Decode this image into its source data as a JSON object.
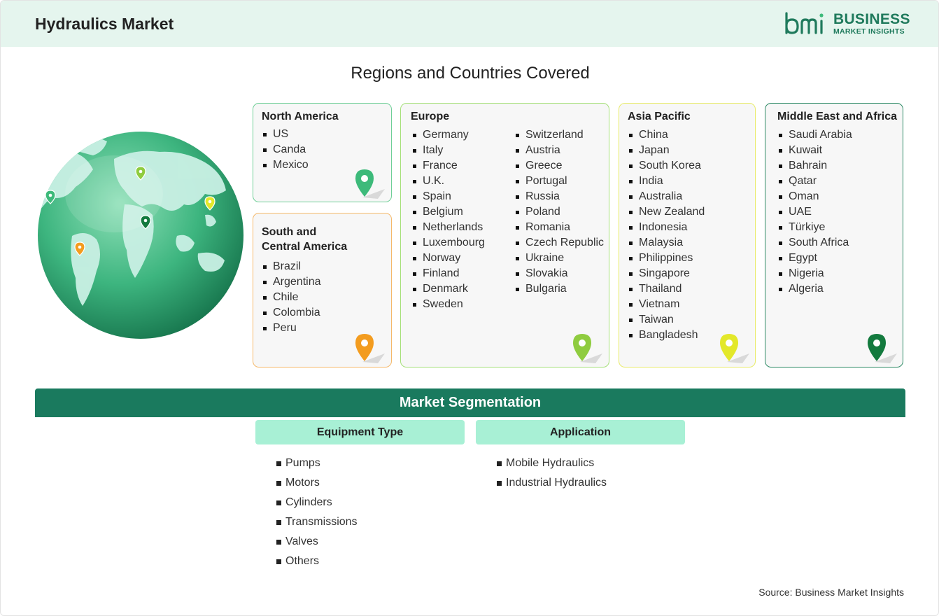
{
  "header": {
    "title": "Hydraulics Market",
    "logo": {
      "brand_line1": "BUSINESS",
      "brand_line2": "MARKET INSIGHTS",
      "color": "#1f7a5c"
    }
  },
  "regions_title": "Regions and Countries Covered",
  "regions": {
    "north_america": {
      "name": "North America",
      "color": "#6fcf97",
      "pin_color": "#3dba7a",
      "countries": [
        "US",
        "Canda",
        "Mexico"
      ]
    },
    "south_central_america": {
      "name_line1": "South and",
      "name_line2": "Central America",
      "color": "#f5b96a",
      "pin_color": "#f39c1f",
      "countries": [
        "Brazil",
        "Argentina",
        "Chile",
        "Colombia",
        "Peru"
      ]
    },
    "europe": {
      "name": "Europe",
      "color": "#a6e07a",
      "pin_color": "#8fcc3f",
      "countries_col1": [
        "Germany",
        "Italy",
        "France",
        "U.K.",
        "Spain",
        "Belgium",
        "Netherlands",
        "Luxembourg",
        "Norway",
        "Finland",
        "Denmark",
        "Sweden"
      ],
      "countries_col2": [
        "Switzerland",
        "Austria",
        "Greece",
        "Portugal",
        "Russia",
        "Poland",
        "Romania",
        "Czech Republic",
        "Ukraine",
        "Slovakia",
        "Bulgaria"
      ]
    },
    "asia_pacific": {
      "name": "Asia Pacific",
      "color": "#e8eb6a",
      "pin_color": "#e3e82a",
      "countries": [
        "China",
        "Japan",
        "South Korea",
        "India",
        "Australia",
        "New Zealand",
        "Indonesia",
        "Malaysia",
        "Philippines",
        "Singapore",
        "Thailand",
        "Vietnam",
        "Taiwan",
        "Bangladesh"
      ]
    },
    "middle_east_africa": {
      "name": "Middle East and Africa",
      "color": "#2e8b66",
      "pin_color": "#137a3e",
      "countries": [
        "Saudi Arabia",
        "Kuwait",
        "Bahrain",
        "Qatar",
        "Oman",
        "UAE",
        "Türkiye",
        "South Africa",
        "Egypt",
        "Nigeria",
        "Algeria"
      ]
    }
  },
  "segmentation": {
    "title": "Market Segmentation",
    "equipment_type": {
      "label": "Equipment Type",
      "items": [
        "Pumps",
        "Motors",
        "Cylinders",
        "Transmissions",
        "Valves",
        "Others"
      ]
    },
    "application": {
      "label": "Application",
      "items": [
        "Mobile Hydraulics",
        "Industrial Hydraulics"
      ]
    }
  },
  "source": "Source: Business Market Insights"
}
